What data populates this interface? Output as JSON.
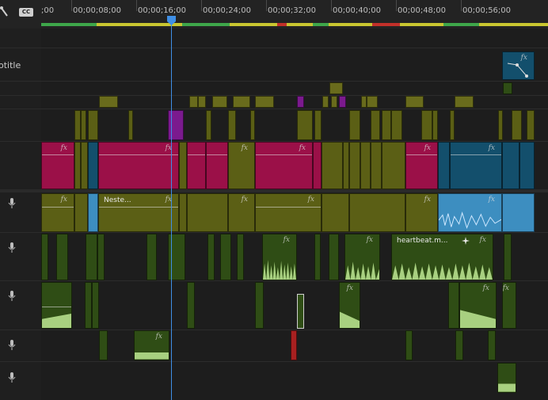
{
  "timeline": {
    "tools": {
      "wrench_icon": "wrench-icon",
      "captions_label": "CC"
    },
    "ruler": {
      "labels": [
        ";00",
        "00;00;08;00",
        "00;00;16;00",
        "00;00;24;00",
        "00;00;32;00",
        "00;00;40;00",
        "00;00;48;00",
        "00;00;56;00"
      ]
    },
    "tracks": {
      "subtitle_label": "otitle",
      "audio_mic_icon": "microphone-icon"
    },
    "clips": {
      "a1_clip_name": "Neste...",
      "a2_clip_name": "heartbeat.m...",
      "fx_badge": "fx"
    },
    "colors": {
      "olive": "#5b5f15",
      "crimson": "#9b1048",
      "teal": "#134f6c",
      "purple": "#7b1a8e",
      "audio_green": "#2f4d15",
      "audio_blue": "#3d8ec0",
      "playhead": "#3f8fe6"
    }
  }
}
